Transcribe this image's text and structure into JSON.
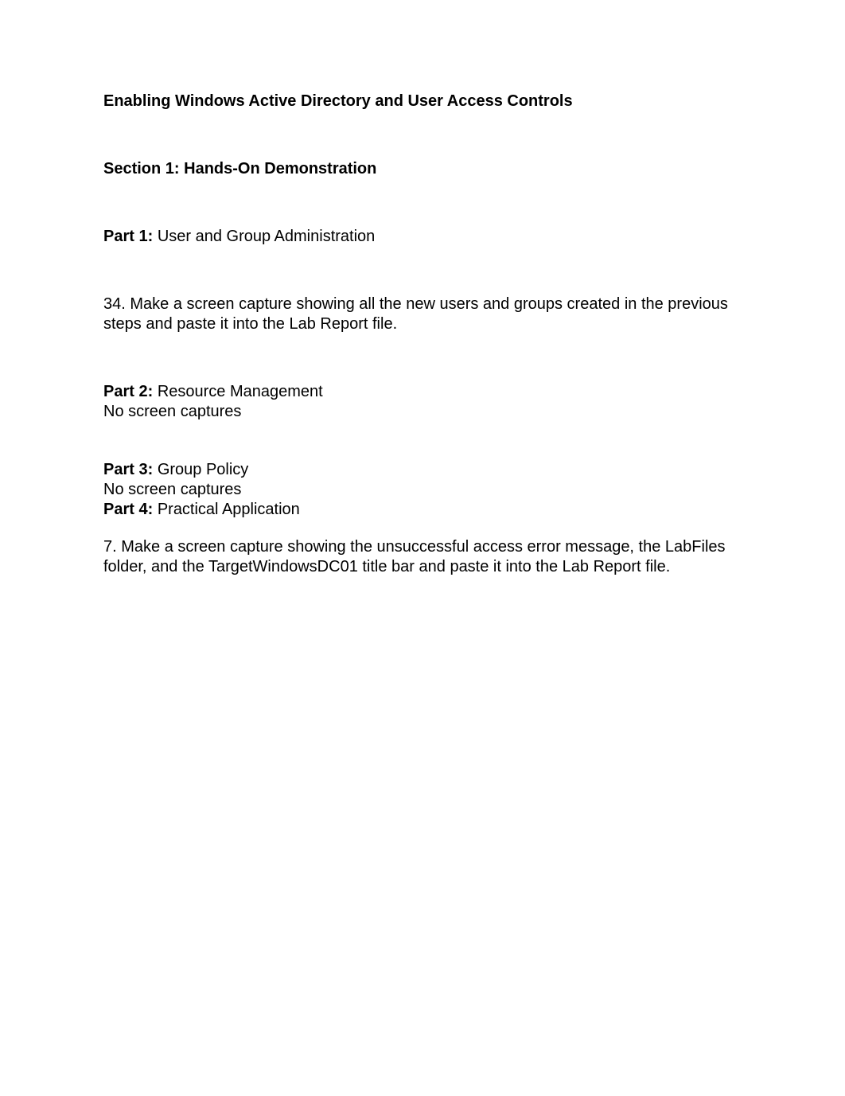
{
  "title": "Enabling Windows Active Directory and User Access Controls",
  "section1": {
    "heading": "Section 1: Hands-On Demonstration"
  },
  "part1": {
    "label": "Part 1: ",
    "title": "User and Group Administration",
    "instruction": "34. Make a screen capture showing all the new users and groups created in the previous steps and paste it into the Lab Report file."
  },
  "part2": {
    "label": "Part 2: ",
    "title": "Resource Management",
    "note": "No screen captures"
  },
  "part3": {
    "label": "Part 3: ",
    "title": "Group Policy",
    "note": "No screen captures"
  },
  "part4": {
    "label": "Part 4: ",
    "title": "Practical Application",
    "instruction": "7. Make a screen capture showing the unsuccessful access error message, the LabFiles folder, and the TargetWindowsDC01 title bar and paste it into the Lab Report file."
  }
}
